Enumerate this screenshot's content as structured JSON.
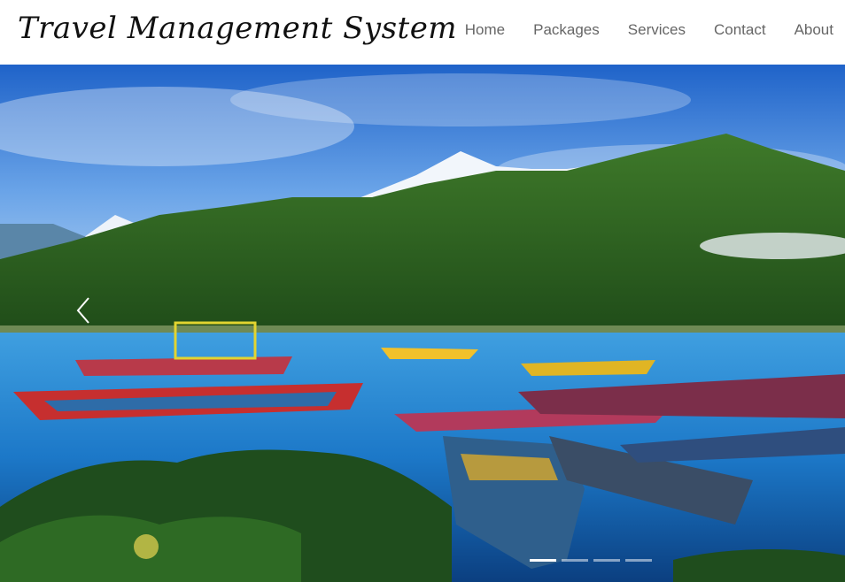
{
  "header": {
    "brand": "Travel Management System",
    "nav": [
      "Home",
      "Packages",
      "Services",
      "Contact",
      "About"
    ]
  },
  "carousel": {
    "prev_icon": "chevron-left-icon",
    "slide_count": 4,
    "active_index": 0
  }
}
